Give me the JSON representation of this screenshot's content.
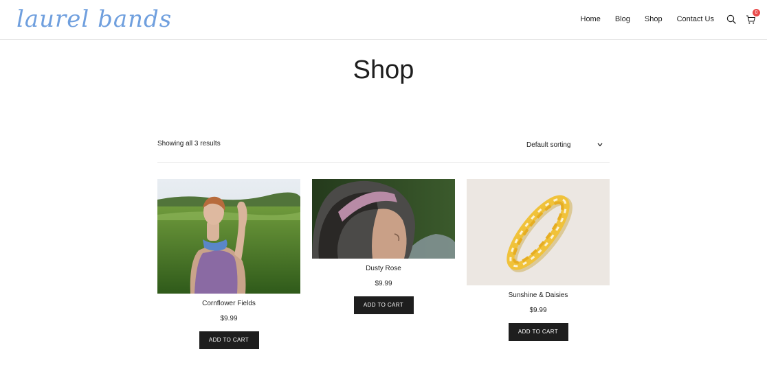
{
  "brand": {
    "logo_text": "laurel bands",
    "logo_color": "#6f9fde"
  },
  "nav": {
    "items": [
      {
        "label": "Home"
      },
      {
        "label": "Blog"
      },
      {
        "label": "Shop"
      },
      {
        "label": "Contact Us"
      }
    ],
    "search_icon": "search-icon",
    "cart_icon": "cart-icon",
    "cart_count": "0",
    "cart_badge_color": "#e94b4b"
  },
  "page": {
    "title": "Shop"
  },
  "toolbar": {
    "result_count": "Showing all 3 results",
    "sort_selected": "Default sorting"
  },
  "products": [
    {
      "name": "Cornflower Fields",
      "price": "$9.99",
      "button": "ADD TO CART"
    },
    {
      "name": "Dusty Rose",
      "price": "$9.99",
      "button": "ADD TO CART"
    },
    {
      "name": "Sunshine & Daisies",
      "price": "$9.99",
      "button": "ADD TO CART"
    }
  ]
}
